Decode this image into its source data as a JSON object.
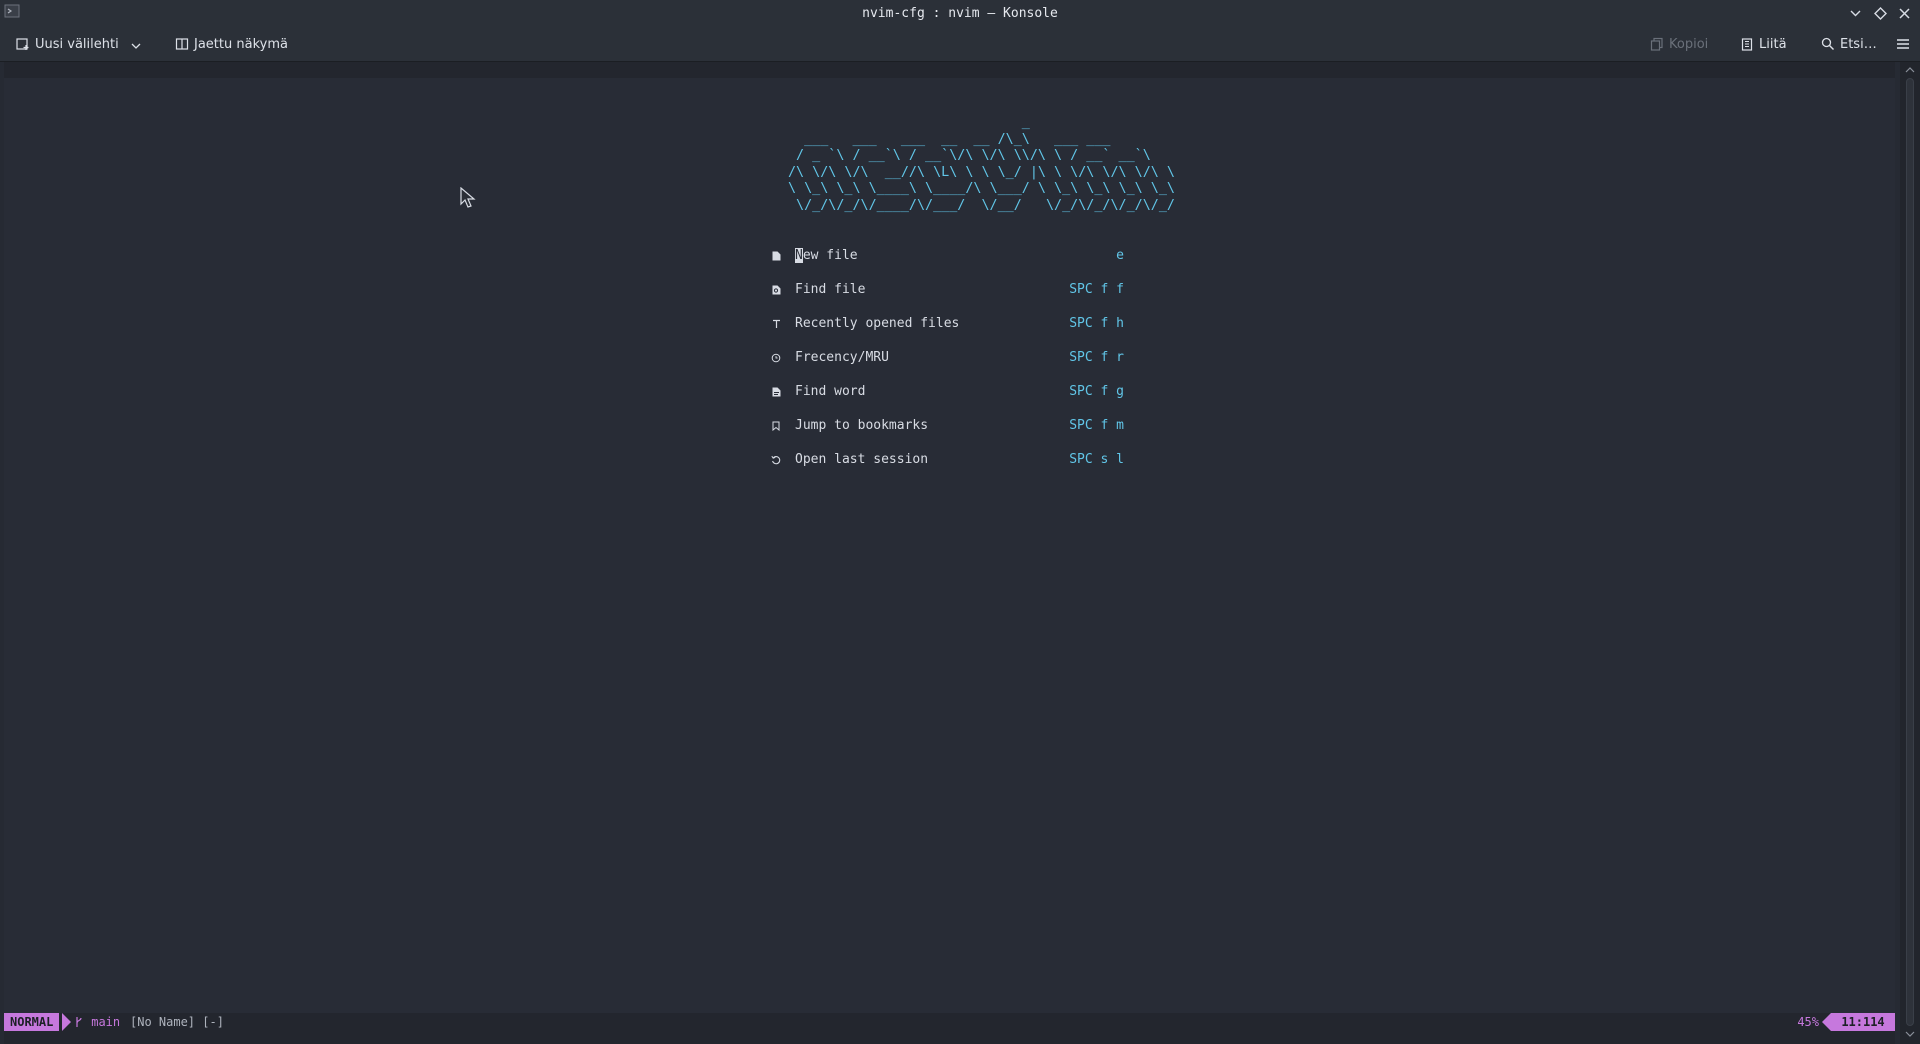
{
  "window": {
    "title": "nvim-cfg : nvim — Konsole",
    "app_icon": "konsole-icon",
    "controls": [
      "minimize-icon",
      "maximize-icon",
      "close-icon"
    ]
  },
  "toolbar": {
    "new_tab_label": "Uusi välilehti",
    "split_view_label": "Jaettu näkymä",
    "copy_label": "Kopioi",
    "paste_label": "Liitä",
    "find_label": "Etsi…"
  },
  "dashboard": {
    "header_ascii": "                             _\n  ___   ___   ___  __  __ /\\_\\   ___ ___\n / _ `\\ / __`\\ / __`\\/\\ \\/\\ \\\\/\\ \\ / __` __`\\\n/\\ \\/\\ \\/\\  __//\\ \\L\\ \\ \\ \\_/ |\\ \\ \\/\\ \\/\\ \\/\\ \\\n\\ \\_\\ \\_\\ \\____\\ \\____/\\ \\___/ \\ \\_\\ \\_\\ \\_\\ \\_\\\n \\/_/\\/_/\\/____/\\/___/  \\/__/   \\/_/\\/_/\\/_/\\/_/",
    "items": [
      {
        "icon": "file-icon",
        "label": "New file",
        "key": "e"
      },
      {
        "icon": "file-search-icon",
        "label": "Find file",
        "key": "SPC f f"
      },
      {
        "icon": "history-icon",
        "label": "Recently opened files",
        "key": "SPC f h"
      },
      {
        "icon": "clock-icon",
        "label": "Frecency/MRU",
        "key": "SPC f r"
      },
      {
        "icon": "file-text-icon",
        "label": "Find word",
        "key": "SPC f g"
      },
      {
        "icon": "bookmark-icon",
        "label": "Jump to bookmarks",
        "key": "SPC f m"
      },
      {
        "icon": "restore-icon",
        "label": "Open last session",
        "key": "SPC s l"
      }
    ]
  },
  "statusline": {
    "mode": "NORMAL",
    "branch_icon": "git-branch-icon",
    "branch": "main",
    "buffer": "[No Name] [-]",
    "percent": "45%",
    "position": "11:114"
  },
  "colors": {
    "accent": "#c678dd",
    "cyan": "#61c6e8",
    "background": "#282c36"
  }
}
